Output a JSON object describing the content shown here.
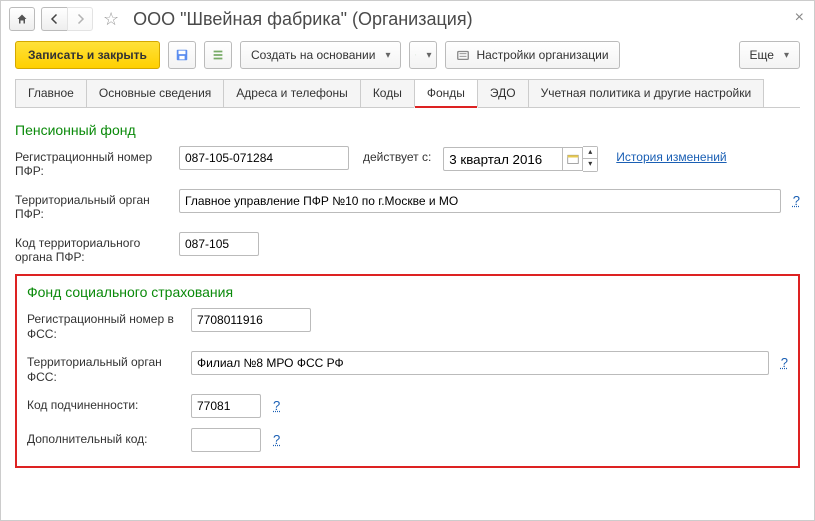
{
  "window": {
    "title": "ООО \"Швейная фабрика\" (Организация)"
  },
  "toolbar": {
    "save_close": "Записать и закрыть",
    "create_based_on": "Создать на основании",
    "org_settings": "Настройки организации",
    "more": "Еще"
  },
  "tabs": {
    "main": "Главное",
    "basic": "Основные сведения",
    "addresses": "Адреса и телефоны",
    "codes": "Коды",
    "funds": "Фонды",
    "edo": "ЭДО",
    "policy": "Учетная политика и другие настройки"
  },
  "pfr": {
    "section_title": "Пенсионный фонд",
    "reg_label": "Регистрационный номер ПФР:",
    "reg_value": "087-105-071284",
    "valid_from_label": "действует с:",
    "valid_from_value": "3 квартал 2016",
    "history_link": "История изменений",
    "territory_label": "Территориальный орган ПФР:",
    "territory_value": "Главное управление ПФР №10 по г.Москве и МО",
    "code_label": "Код территориального органа ПФР:",
    "code_value": "087-105"
  },
  "fss": {
    "section_title": "Фонд социального страхования",
    "reg_label": "Регистрационный номер в ФСС:",
    "reg_value": "7708011916",
    "territory_label": "Территориальный орган ФСС:",
    "territory_value": "Филиал №8 МРО ФСС РФ",
    "subord_label": "Код подчиненности:",
    "subord_value": "77081",
    "extra_label": "Дополнительный код:",
    "extra_value": ""
  },
  "help_char": "?"
}
